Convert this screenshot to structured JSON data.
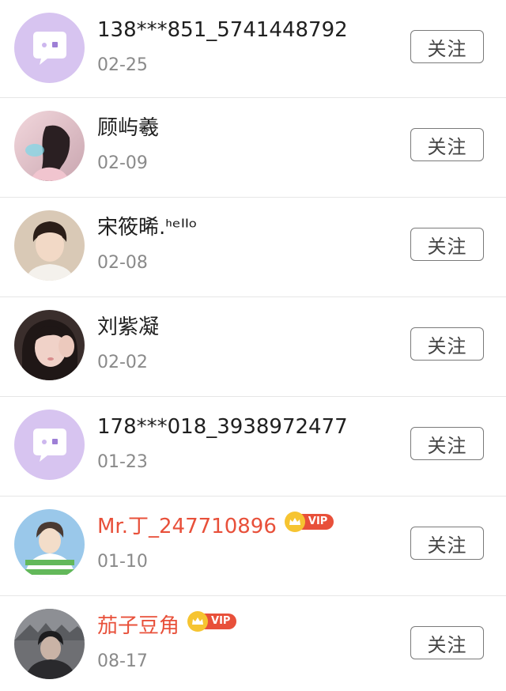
{
  "users": [
    {
      "name": "138***851_5741448792",
      "date": "02-25",
      "vip": false,
      "avatar": "default-chat-avatar",
      "follow_label": "关注"
    },
    {
      "name": "顾屿羲",
      "date": "02-09",
      "vip": false,
      "avatar": "photo-avatar",
      "follow_label": "关注"
    },
    {
      "name": "宋筱晞.ᑋᵉᑊᑊᵒ",
      "date": "02-08",
      "vip": false,
      "avatar": "photo-avatar",
      "follow_label": "关注"
    },
    {
      "name": "刘紫凝",
      "date": "02-02",
      "vip": false,
      "avatar": "photo-avatar",
      "follow_label": "关注"
    },
    {
      "name": "178***018_3938972477",
      "date": "01-23",
      "vip": false,
      "avatar": "default-chat-avatar",
      "follow_label": "关注"
    },
    {
      "name": "Mr.丁_247710896",
      "date": "01-10",
      "vip": true,
      "vip_label": "VIP",
      "avatar": "photo-avatar",
      "follow_label": "关注"
    },
    {
      "name": "茄子豆角",
      "date": "08-17",
      "vip": true,
      "vip_label": "VIP",
      "avatar": "photo-avatar",
      "follow_label": "关注"
    }
  ],
  "colors": {
    "vip_name": "#e8503a",
    "default_avatar_bg": "#d7c4f0",
    "vip_badge": "#e8503a",
    "crown": "#f6c431"
  }
}
